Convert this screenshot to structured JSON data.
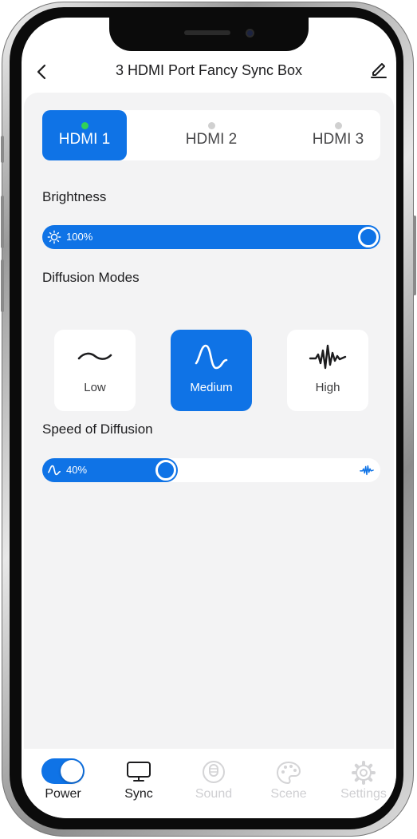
{
  "header": {
    "title": "3 HDMI Port Fancy Sync Box",
    "back_icon": "chevron-left-icon",
    "edit_icon": "pencil-icon"
  },
  "tabs": [
    {
      "label": "HDMI 1",
      "active": true,
      "status_color": "#31d158"
    },
    {
      "label": "HDMI 2",
      "active": false,
      "status_color": "#d0d0d0"
    },
    {
      "label": "HDMI 3",
      "active": false,
      "status_color": "#d0d0d0"
    }
  ],
  "brightness": {
    "label": "Brightness",
    "value_text": "100%",
    "value": 1.0,
    "icon": "sun-icon"
  },
  "diffusion": {
    "label": "Diffusion Modes",
    "modes": [
      {
        "label": "Low",
        "icon": "tilde-wave-icon",
        "active": false
      },
      {
        "label": "Medium",
        "icon": "sine-wave-icon",
        "active": true
      },
      {
        "label": "High",
        "icon": "spiky-wave-icon",
        "active": false
      }
    ]
  },
  "speed": {
    "label": "Speed of Diffusion",
    "value_text": "40%",
    "value": 0.4,
    "icon": "sine-wave-icon",
    "end_icon": "spiky-wave-icon"
  },
  "bottom_nav": [
    {
      "label": "Power",
      "icon": "toggle-switch",
      "enabled": true
    },
    {
      "label": "Sync",
      "icon": "tv-icon",
      "enabled": true
    },
    {
      "label": "Sound",
      "icon": "microphone-icon",
      "enabled": false
    },
    {
      "label": "Scene",
      "icon": "palette-icon",
      "enabled": false
    },
    {
      "label": "Settings",
      "icon": "gear-icon",
      "enabled": false
    }
  ],
  "colors": {
    "accent": "#0f73e6",
    "background": "#f3f3f4"
  }
}
